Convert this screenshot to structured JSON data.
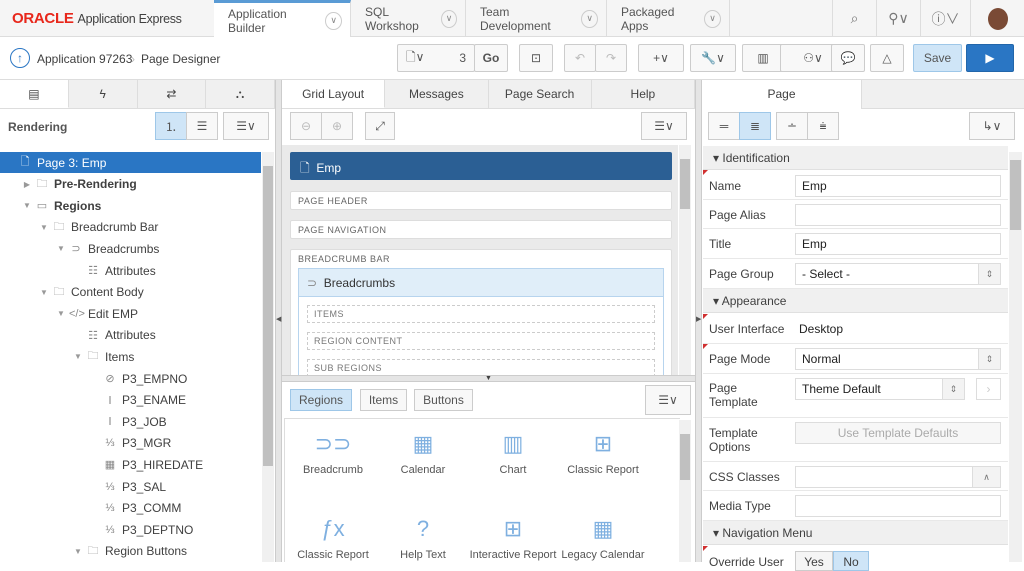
{
  "header": {
    "brand": "ORACLE",
    "product": "Application Express",
    "tabs": [
      {
        "label": "Application Builder",
        "active": true
      },
      {
        "label": "SQL Workshop"
      },
      {
        "label": "Team Development"
      },
      {
        "label": "Packaged Apps"
      }
    ],
    "icons": [
      "search-icon",
      "user-settings-icon",
      "help-icon",
      "avatar"
    ]
  },
  "toolbar": {
    "breadcrumb": [
      "Application 97263",
      "Page Designer"
    ],
    "page_number": "3",
    "go": "Go",
    "save": "Save",
    "run_icon": "run-icon"
  },
  "left": {
    "tabs": [
      "rendering-icon",
      "dynamic-actions-icon",
      "processing-icon",
      "shared-components-icon"
    ],
    "title": "Rendering",
    "tree": [
      {
        "label": "Page 3: Emp",
        "level": 0,
        "icon": "page",
        "selected": true
      },
      {
        "label": "Pre-Rendering",
        "level": 1,
        "icon": "folder",
        "toggle": "▶"
      },
      {
        "label": "Regions",
        "level": 1,
        "icon": "regions",
        "toggle": "▼"
      },
      {
        "label": "Breadcrumb Bar",
        "level": 2,
        "icon": "folder",
        "toggle": "▼"
      },
      {
        "label": "Breadcrumbs",
        "level": 3,
        "icon": "breadcrumb",
        "toggle": "▼"
      },
      {
        "label": "Attributes",
        "level": 4,
        "icon": "attributes"
      },
      {
        "label": "Content Body",
        "level": 2,
        "icon": "folder",
        "toggle": "▼"
      },
      {
        "label": "Edit EMP",
        "level": 3,
        "icon": "code",
        "toggle": "▼"
      },
      {
        "label": "Attributes",
        "level": 4,
        "icon": "attributes"
      },
      {
        "label": "Items",
        "level": 4,
        "icon": "folder",
        "toggle": "▼"
      },
      {
        "label": "P3_EMPNO",
        "level": 5,
        "icon": "hidden"
      },
      {
        "label": "P3_ENAME",
        "level": 5,
        "icon": "text"
      },
      {
        "label": "P3_JOB",
        "level": 5,
        "icon": "text"
      },
      {
        "label": "P3_MGR",
        "level": 5,
        "icon": "number"
      },
      {
        "label": "P3_HIREDATE",
        "level": 5,
        "icon": "date"
      },
      {
        "label": "P3_SAL",
        "level": 5,
        "icon": "number"
      },
      {
        "label": "P3_COMM",
        "level": 5,
        "icon": "number"
      },
      {
        "label": "P3_DEPTNO",
        "level": 5,
        "icon": "number"
      },
      {
        "label": "Region Buttons",
        "level": 4,
        "icon": "folder",
        "toggle": "▼"
      }
    ]
  },
  "middle": {
    "tabs": [
      "Grid Layout",
      "Messages",
      "Page Search",
      "Help"
    ],
    "page_title": "Emp",
    "page_header": "PAGE HEADER",
    "page_navigation": "PAGE NAVIGATION",
    "breadcrumb_bar": "BREADCRUMB BAR",
    "breadcrumbs_region": "Breadcrumbs",
    "slots": [
      "ITEMS",
      "REGION CONTENT",
      "SUB REGIONS"
    ],
    "gallery_tabs": [
      "Regions",
      "Items",
      "Buttons"
    ],
    "gallery": [
      {
        "label": "Breadcrumb",
        "icon": "⊃⊃"
      },
      {
        "label": "Calendar",
        "icon": "▦"
      },
      {
        "label": "Chart",
        "icon": "▥"
      },
      {
        "label": "Classic Report",
        "icon": "⊞"
      },
      {
        "label": "Classic Report",
        "icon": "ƒx"
      },
      {
        "label": "Help Text",
        "icon": "?"
      },
      {
        "label": "Interactive Report",
        "icon": "⊞"
      },
      {
        "label": "Legacy Calendar",
        "icon": "▦"
      }
    ]
  },
  "right": {
    "tab": "Page",
    "sections": {
      "identification": "Identification",
      "appearance": "Appearance",
      "navigation": "Navigation Menu"
    },
    "props": {
      "name": {
        "label": "Name",
        "value": "Emp"
      },
      "alias": {
        "label": "Page Alias",
        "value": ""
      },
      "title": {
        "label": "Title",
        "value": "Emp"
      },
      "group": {
        "label": "Page Group",
        "value": "- Select -"
      },
      "ui": {
        "label": "User Interface",
        "value": "Desktop"
      },
      "mode": {
        "label": "Page Mode",
        "value": "Normal"
      },
      "template": {
        "label": "Page\nTemplate",
        "value": "Theme Default"
      },
      "options": {
        "label": "Template\nOptions",
        "value": "Use Template Defaults"
      },
      "css": {
        "label": "CSS Classes",
        "value": ""
      },
      "media": {
        "label": "Media Type",
        "value": ""
      },
      "override": {
        "label": "Override User",
        "yes": "Yes",
        "no": "No"
      }
    }
  },
  "colors": {
    "accent": "#2a76c4",
    "selected_bg": "#cfe5f7",
    "oracle_red": "#e8271b"
  }
}
